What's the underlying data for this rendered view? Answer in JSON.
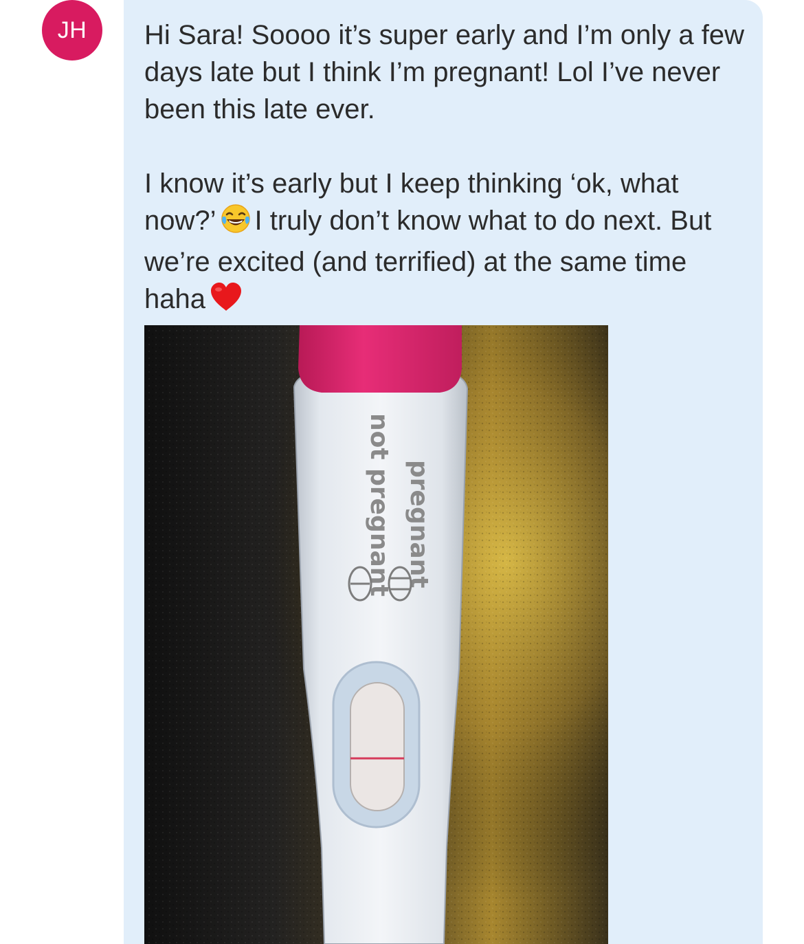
{
  "sender": {
    "initials": "JH",
    "avatar_color": "#d81b60"
  },
  "message": {
    "line_1": "Hi Sara! Soooo it’s super early and I’m only a few days late but I think I’m pregnant! Lol I’ve never been this late ever.",
    "line_2_part_1": "I know it’s early but I keep thinking ‘ok, what now?’",
    "line_2_part_2": "I truly don’t know what to do next. But we’re excited (and terrified) at the same time haha",
    "emoji_1": "face-with-tears-of-joy",
    "emoji_2": "red-heart"
  },
  "attachment": {
    "type": "photo",
    "subject": "pregnancy-test",
    "test_labels": {
      "positive": "pregnant",
      "negative": "not pregnant"
    },
    "result_lines_visible": 1,
    "cap_color": "#e0226e",
    "line_color": "#d63a5a"
  },
  "theme": {
    "bubble_color": "#e1eefa",
    "text_color": "#2b2b2b"
  }
}
